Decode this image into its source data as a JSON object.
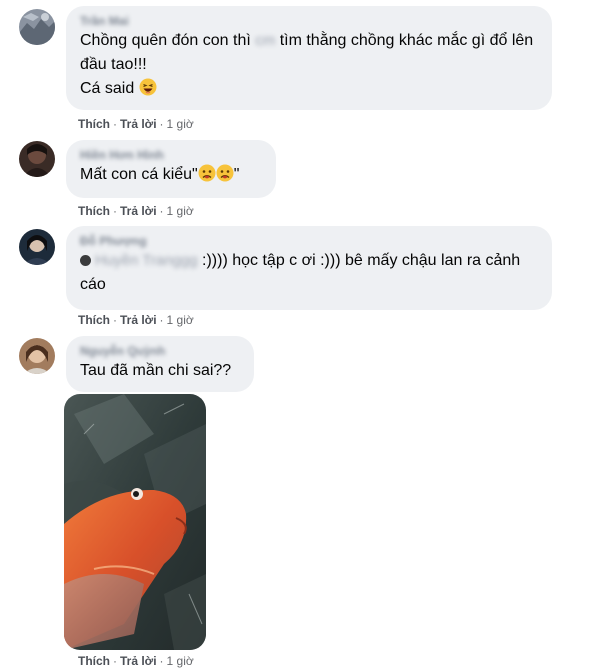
{
  "comments": [
    {
      "author": "Trần Mai",
      "text_before": "Chồng quên đón con thì ",
      "censored": "cm",
      "text_after": " tìm thằng chồng khác mắc gì đổ lên đầu tao!!!",
      "line2": "Cá said",
      "emoji": "laughing-emoji-icon"
    },
    {
      "author": "Hiền Hơn Hình",
      "text": "Mất con cá kiểu\"",
      "text_end": "\""
    },
    {
      "author": "Đỗ Phượng",
      "mention": "Huyền Tranggg",
      "text": " :)))) học tập c ơi :))) bê mấy chậu lan ra cảnh cáo"
    },
    {
      "author": "Nguyễn Quỳnh",
      "text": "Tau đã mần chi sai??"
    }
  ],
  "actions": {
    "like": "Thích",
    "reply": "Trả lời",
    "dot": "·",
    "time": "1 giờ"
  }
}
